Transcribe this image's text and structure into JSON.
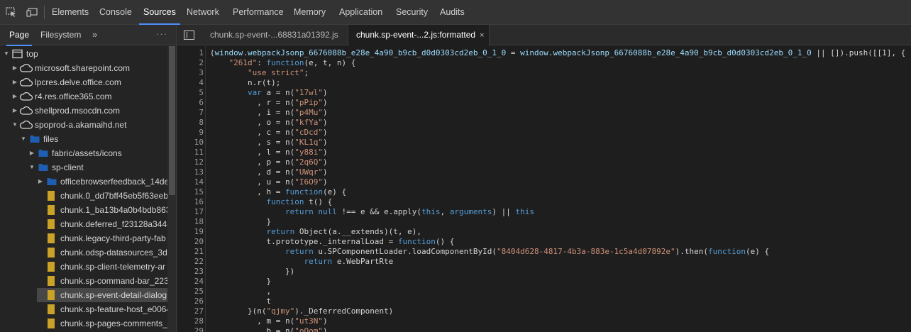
{
  "toolbar": {
    "tabs": [
      "Elements",
      "Console",
      "Sources",
      "Network",
      "Performance",
      "Memory",
      "Application",
      "Security",
      "Audits"
    ],
    "active_tab": "Sources",
    "inspect_icon": "inspect-element-icon",
    "device_icon": "device-toolbar-icon"
  },
  "navigator": {
    "tabs": [
      "Page",
      "Filesystem"
    ],
    "active_tab": "Page",
    "more_label": "»",
    "menu_label": "⋮",
    "tree": [
      {
        "label": "top",
        "icon": "window-icon",
        "expanded": true
      },
      {
        "label": "microsoft.sharepoint.com",
        "icon": "cloud-icon",
        "expanded": false
      },
      {
        "label": "lpcres.delve.office.com",
        "icon": "cloud-icon",
        "expanded": false
      },
      {
        "label": "r4.res.office365.com",
        "icon": "cloud-icon",
        "expanded": false
      },
      {
        "label": "shellprod.msocdn.com",
        "icon": "cloud-icon",
        "expanded": false
      },
      {
        "label": "spoprod-a.akamaihd.net",
        "icon": "cloud-icon",
        "expanded": true
      },
      {
        "label": "files",
        "icon": "folder-icon",
        "expanded": true
      },
      {
        "label": "fabric/assets/icons",
        "icon": "folder-icon",
        "expanded": false
      },
      {
        "label": "sp-client",
        "icon": "folder-icon",
        "expanded": true
      },
      {
        "label": "officebrowserfeedback_14de",
        "icon": "folder-icon",
        "expanded": false
      },
      {
        "label": "chunk.0_dd7bff45eb5f63eeb",
        "icon": "file-icon"
      },
      {
        "label": "chunk.1_ba13b4a0b4bdb863",
        "icon": "file-icon"
      },
      {
        "label": "chunk.deferred_f23128a3448",
        "icon": "file-icon"
      },
      {
        "label": "chunk.legacy-third-party-fab",
        "icon": "file-icon"
      },
      {
        "label": "chunk.odsp-datasources_3d5",
        "icon": "file-icon"
      },
      {
        "label": "chunk.sp-client-telemetry-ar",
        "icon": "file-icon"
      },
      {
        "label": "chunk.sp-command-bar_223",
        "icon": "file-icon"
      },
      {
        "label": "chunk.sp-event-detail-dialog",
        "icon": "file-icon",
        "selected": true
      },
      {
        "label": "chunk.sp-feature-host_e0064",
        "icon": "file-icon"
      },
      {
        "label": "chunk.sp-pages-comments_",
        "icon": "file-icon"
      }
    ]
  },
  "editor": {
    "toggle_icon": "toggle-navigator-icon",
    "tabs": [
      {
        "label": "chunk.sp-event-...68831a01392.js",
        "active": false
      },
      {
        "label": "chunk.sp-event-...2.js:formatted",
        "active": true,
        "close": "×"
      }
    ],
    "line_numbers": [
      "1",
      "2",
      "3",
      "4",
      "5",
      "6",
      "7",
      "8",
      "9",
      "10",
      "11",
      "12",
      "13",
      "14",
      "15",
      "16",
      "17",
      "18",
      "19",
      "20",
      "21",
      "22",
      "23",
      "24",
      "25",
      "26",
      "27",
      "28",
      "29"
    ],
    "lines": [
      [
        [
          "p",
          "("
        ],
        [
          "v",
          "window"
        ],
        [
          "p",
          "."
        ],
        [
          "v",
          "webpackJsonp_6676088b_e28e_4a90_b9cb_d0d0303cd2eb_0_1_0"
        ],
        [
          "p",
          " = "
        ],
        [
          "v",
          "window"
        ],
        [
          "p",
          "."
        ],
        [
          "v",
          "webpackJsonp_6676088b_e28e_4a90_b9cb_d0d0303cd2eb_0_1_0"
        ],
        [
          "p",
          " || []).push([[1], {"
        ]
      ],
      [
        [
          "p",
          "    "
        ],
        [
          "s",
          "\"261d\""
        ],
        [
          "p",
          ": "
        ],
        [
          "k",
          "function"
        ],
        [
          "p",
          "(e, t, n) {"
        ]
      ],
      [
        [
          "p",
          "        "
        ],
        [
          "s",
          "\"use strict\""
        ],
        [
          "p",
          ";"
        ]
      ],
      [
        [
          "p",
          "        n.r(t);"
        ]
      ],
      [
        [
          "p",
          "        "
        ],
        [
          "k",
          "var"
        ],
        [
          "p",
          " a = n("
        ],
        [
          "s",
          "\"17wl\""
        ],
        [
          "p",
          ")"
        ]
      ],
      [
        [
          "p",
          "          , r = n("
        ],
        [
          "s",
          "\"pPip\""
        ],
        [
          "p",
          ")"
        ]
      ],
      [
        [
          "p",
          "          , i = n("
        ],
        [
          "s",
          "\"p4Mu\""
        ],
        [
          "p",
          ")"
        ]
      ],
      [
        [
          "p",
          "          , o = n("
        ],
        [
          "s",
          "\"kfYa\""
        ],
        [
          "p",
          ")"
        ]
      ],
      [
        [
          "p",
          "          , c = n("
        ],
        [
          "s",
          "\"cDcd\""
        ],
        [
          "p",
          ")"
        ]
      ],
      [
        [
          "p",
          "          , s = n("
        ],
        [
          "s",
          "\"KL1q\""
        ],
        [
          "p",
          ")"
        ]
      ],
      [
        [
          "p",
          "          , l = n("
        ],
        [
          "s",
          "\"y88i\""
        ],
        [
          "p",
          ")"
        ]
      ],
      [
        [
          "p",
          "          , p = n("
        ],
        [
          "s",
          "\"2q6Q\""
        ],
        [
          "p",
          ")"
        ]
      ],
      [
        [
          "p",
          "          , d = n("
        ],
        [
          "s",
          "\"UWqr\""
        ],
        [
          "p",
          ")"
        ]
      ],
      [
        [
          "p",
          "          , u = n("
        ],
        [
          "s",
          "\"I6O9\""
        ],
        [
          "p",
          ")"
        ]
      ],
      [
        [
          "p",
          "          , h = "
        ],
        [
          "k",
          "function"
        ],
        [
          "p",
          "(e) {"
        ]
      ],
      [
        [
          "p",
          "            "
        ],
        [
          "k",
          "function"
        ],
        [
          "p",
          " t() {"
        ]
      ],
      [
        [
          "p",
          "                "
        ],
        [
          "k",
          "return"
        ],
        [
          "p",
          " "
        ],
        [
          "k",
          "null"
        ],
        [
          "p",
          " !== e && e.apply("
        ],
        [
          "k",
          "this"
        ],
        [
          "p",
          ", "
        ],
        [
          "k",
          "arguments"
        ],
        [
          "p",
          ") || "
        ],
        [
          "k",
          "this"
        ]
      ],
      [
        [
          "p",
          "            }"
        ]
      ],
      [
        [
          "p",
          "            "
        ],
        [
          "k",
          "return"
        ],
        [
          "p",
          " Object(a.__extends)(t, e),"
        ]
      ],
      [
        [
          "p",
          "            t.prototype._internalLoad = "
        ],
        [
          "k",
          "function"
        ],
        [
          "p",
          "() {"
        ]
      ],
      [
        [
          "p",
          "                "
        ],
        [
          "k",
          "return"
        ],
        [
          "p",
          " u.SPComponentLoader.loadComponentById("
        ],
        [
          "s",
          "\"8404d628-4817-4b3a-883e-1c5a4d07892e\""
        ],
        [
          "p",
          ").then("
        ],
        [
          "k",
          "function"
        ],
        [
          "p",
          "(e) {"
        ]
      ],
      [
        [
          "p",
          "                    "
        ],
        [
          "k",
          "return"
        ],
        [
          "p",
          " e.WebPartRte"
        ]
      ],
      [
        [
          "p",
          "                })"
        ]
      ],
      [
        [
          "p",
          "            }"
        ]
      ],
      [
        [
          "p",
          "            ,"
        ]
      ],
      [
        [
          "p",
          "            t"
        ]
      ],
      [
        [
          "p",
          "        }(n("
        ],
        [
          "s",
          "\"qjmy\""
        ],
        [
          "p",
          ")._DeferredComponent)"
        ]
      ],
      [
        [
          "p",
          "          , m = n("
        ],
        [
          "s",
          "\"ut3N\""
        ],
        [
          "p",
          ")"
        ]
      ],
      [
        [
          "p",
          "          , b = n("
        ],
        [
          "s",
          "\"oQom\""
        ],
        [
          "p",
          ")"
        ]
      ]
    ]
  },
  "colors": {
    "accent": "#4d90fe",
    "keyword": "#569cd6",
    "string": "#ce9178",
    "variable": "#9cdcfe",
    "folder": "#1f5fb3",
    "file": "#c9a227"
  }
}
